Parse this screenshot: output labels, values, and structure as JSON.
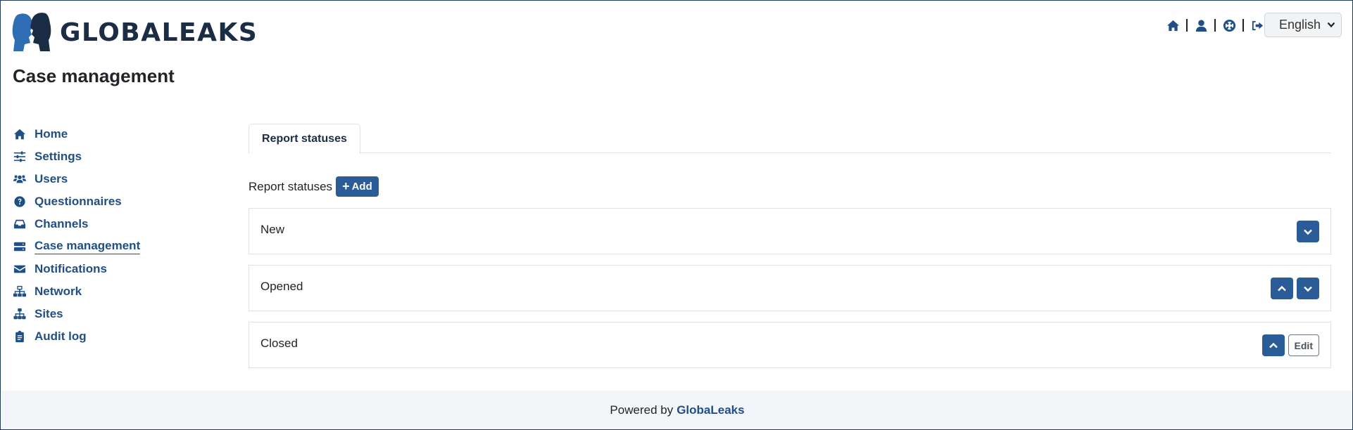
{
  "app": {
    "logo_text": "GLOBALEAKS"
  },
  "page": {
    "title": "Case management"
  },
  "header": {
    "icons": [
      "home-icon",
      "user-icon",
      "support-icon",
      "logout-icon"
    ],
    "language": {
      "selected": "English"
    }
  },
  "sidebar": {
    "items": [
      {
        "label": "Home",
        "icon": "home-icon"
      },
      {
        "label": "Settings",
        "icon": "sliders-icon"
      },
      {
        "label": "Users",
        "icon": "users-icon"
      },
      {
        "label": "Questionnaires",
        "icon": "question-circle-icon"
      },
      {
        "label": "Channels",
        "icon": "inbox-icon"
      },
      {
        "label": "Case management",
        "icon": "server-icon",
        "active": true
      },
      {
        "label": "Notifications",
        "icon": "envelope-icon"
      },
      {
        "label": "Network",
        "icon": "network-icon"
      },
      {
        "label": "Sites",
        "icon": "sitemap-icon"
      },
      {
        "label": "Audit log",
        "icon": "clipboard-icon"
      }
    ]
  },
  "main": {
    "tabs": [
      {
        "label": "Report statuses",
        "active": true
      }
    ],
    "section_label": "Report statuses",
    "add_label": "Add",
    "statuses": [
      {
        "name": "New",
        "actions": [
          "down"
        ]
      },
      {
        "name": "Opened",
        "actions": [
          "up",
          "down"
        ]
      },
      {
        "name": "Closed",
        "actions": [
          "up",
          "edit"
        ]
      }
    ],
    "edit_label": "Edit"
  },
  "footer": {
    "prefix": "Powered by",
    "brand": "GlobaLeaks"
  },
  "colors": {
    "primary": "#2a5d98",
    "link": "#1f4f86",
    "footer_bg": "#f3f5f8"
  }
}
